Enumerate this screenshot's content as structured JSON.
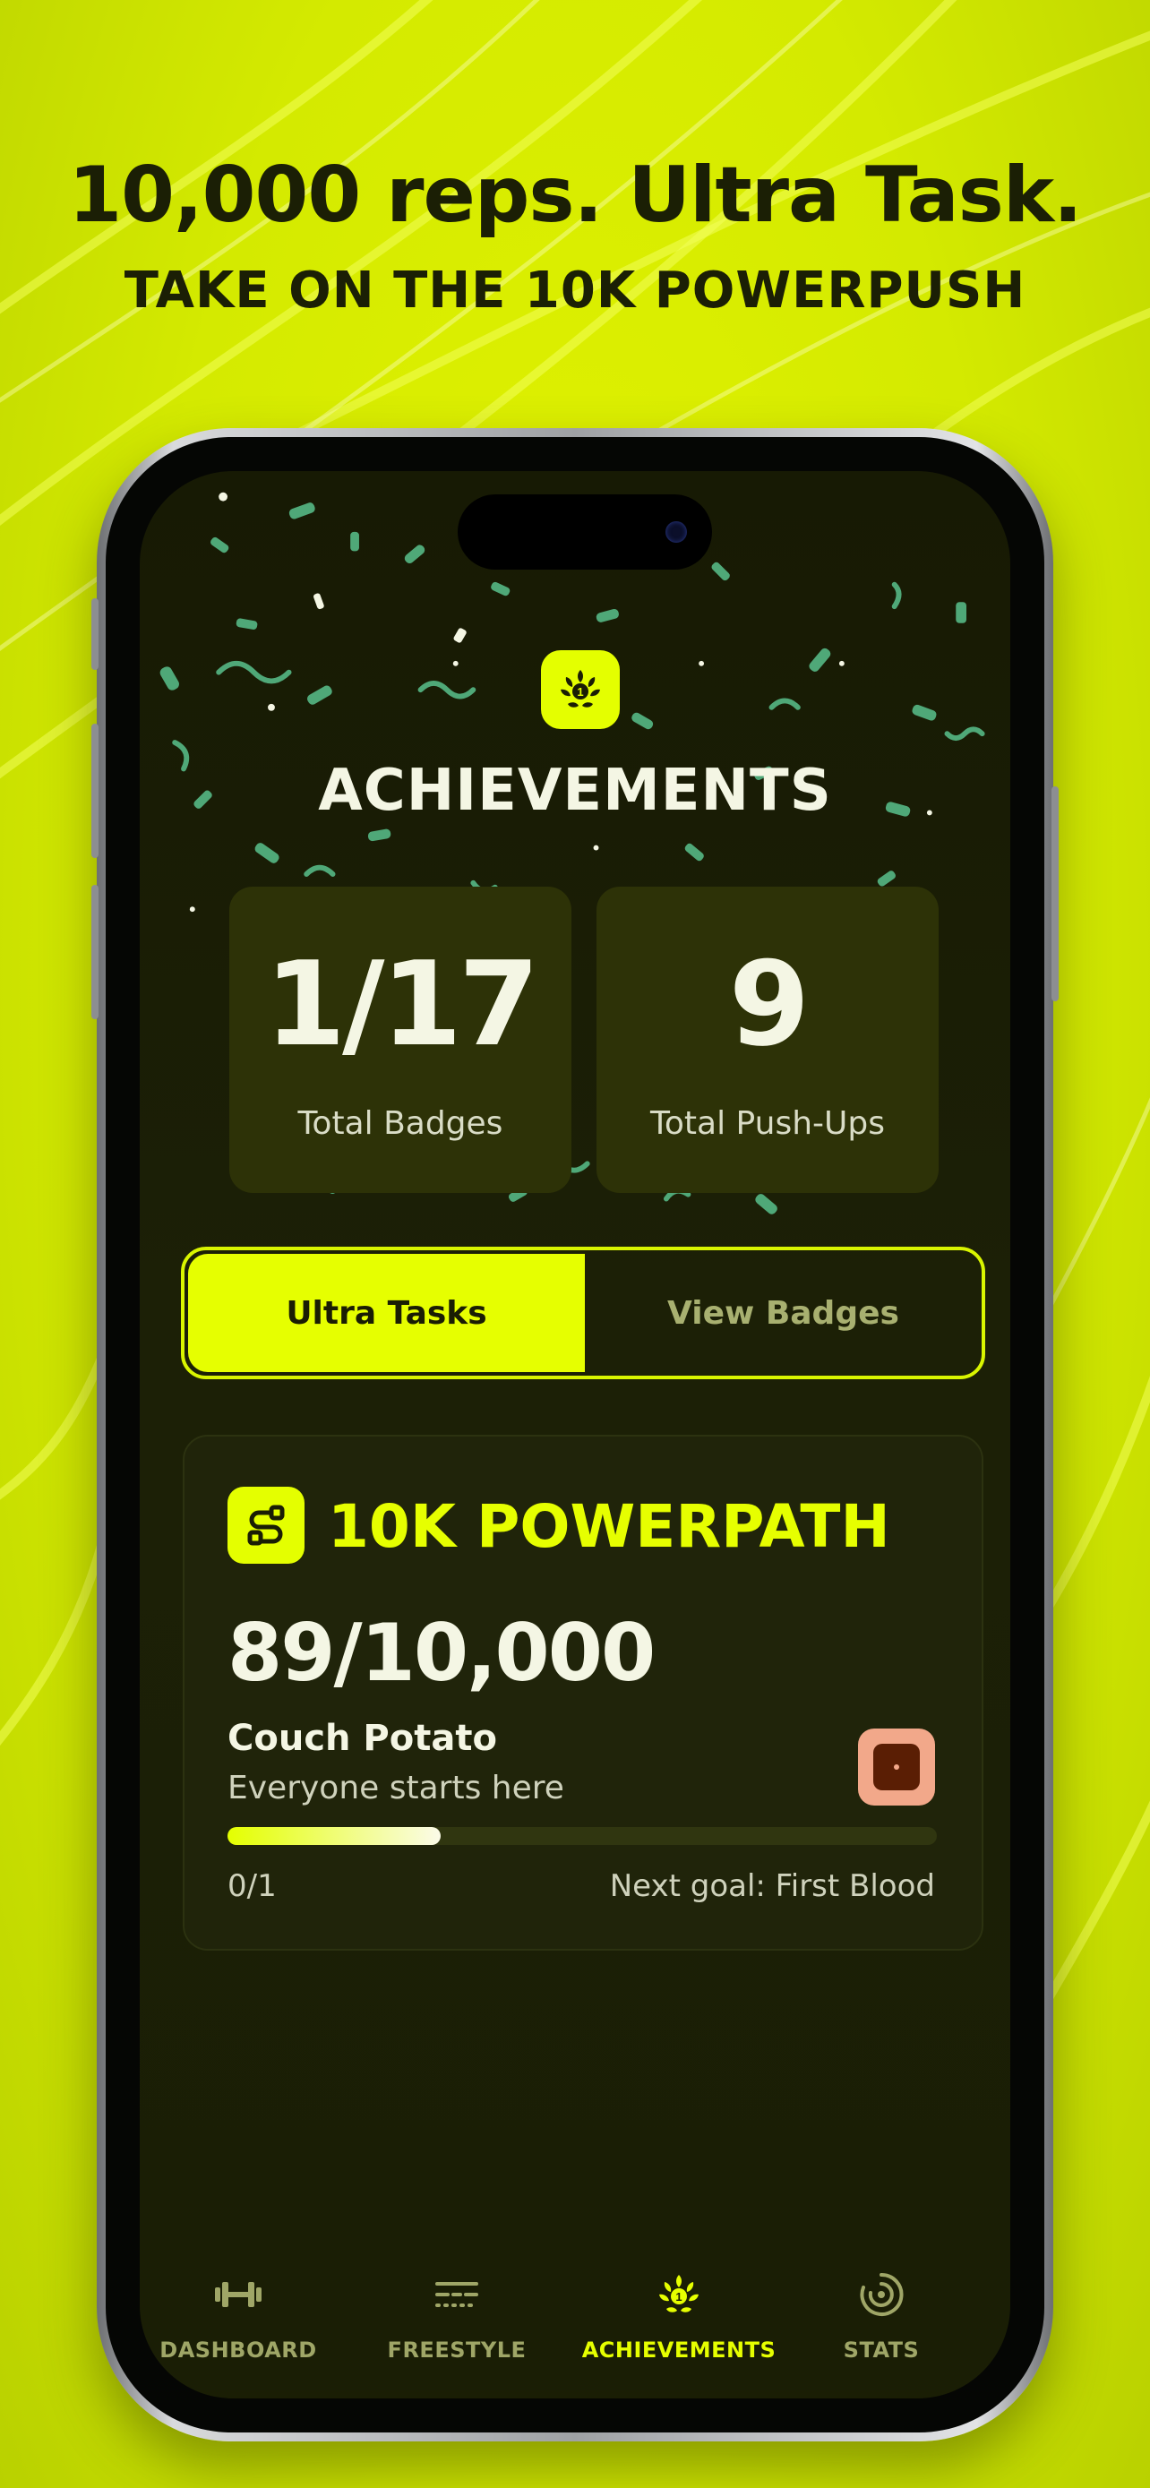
{
  "promo": {
    "headline": "10,000 reps. Ultra Task.",
    "subheadline": "TAKE ON THE 10K POWERPUSH"
  },
  "colors": {
    "brand_accent": "#e4ff00",
    "screen_background": "#1c2006",
    "card_background": "#2d3207",
    "rank_badge": "#f2a88a"
  },
  "header": {
    "icon": "achievement-laurel-icon",
    "title": "ACHIEVEMENTS"
  },
  "stats": [
    {
      "value": "1/17",
      "label": "Total Badges"
    },
    {
      "value": "9",
      "label": "Total Push-Ups"
    }
  ],
  "segmented_control": {
    "options": [
      {
        "label": "Ultra Tasks",
        "selected": true
      },
      {
        "label": "View Badges",
        "selected": false
      }
    ]
  },
  "ultra_task": {
    "icon": "path-route-icon",
    "title": "10K POWERPATH",
    "count": "89/10,000",
    "rank_name": "Couch Potato",
    "rank_description": "Everyone starts here",
    "rank_badge_icon": "rank-badge-icon",
    "progress_fraction": 0.3,
    "progress_label": "0/1",
    "next_goal": "Next goal: First Blood"
  },
  "tabbar": {
    "tabs": [
      {
        "label": "DASHBOARD",
        "icon": "dumbbell-icon",
        "active": false
      },
      {
        "label": "FREESTYLE",
        "icon": "freestyle-lines-icon",
        "active": false
      },
      {
        "label": "ACHIEVEMENTS",
        "icon": "achievement-laurel-icon",
        "active": true
      },
      {
        "label": "STATS",
        "icon": "stats-target-icon",
        "active": false
      }
    ]
  }
}
